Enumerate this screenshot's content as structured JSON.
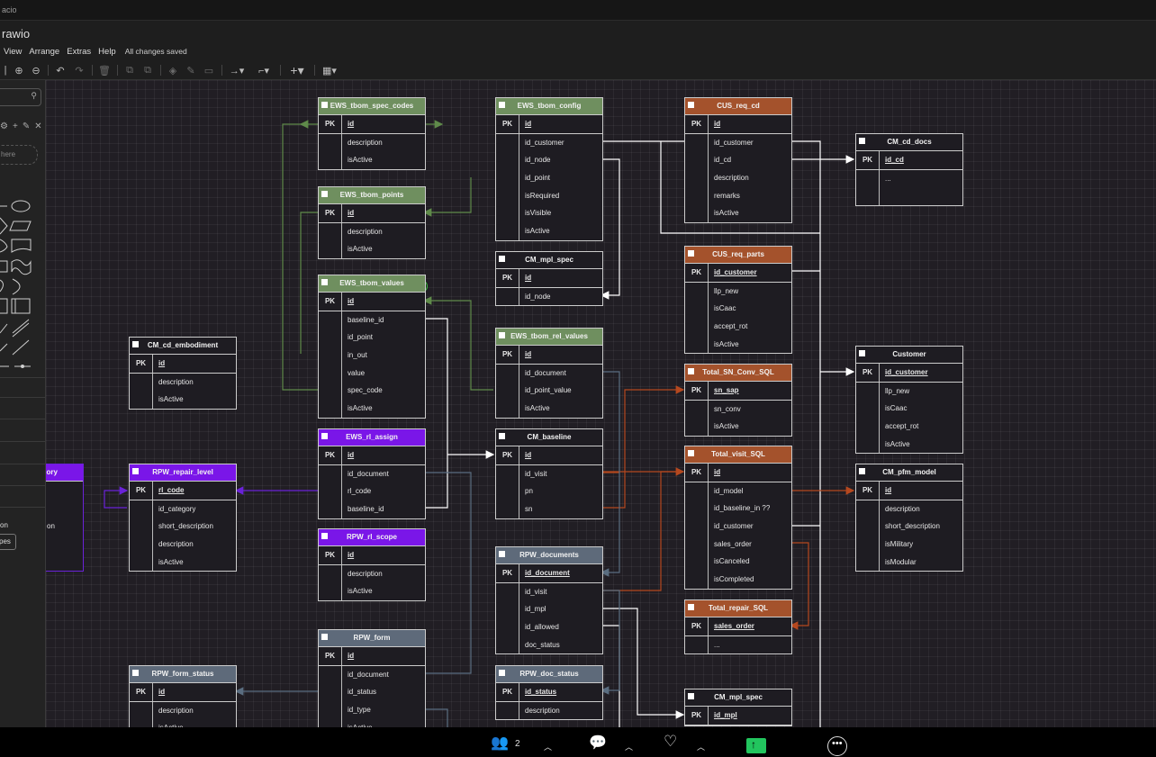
{
  "titlebar": {
    "text": "acio"
  },
  "app": {
    "title": "rawio"
  },
  "menu": {
    "items": [
      "View",
      "Arrange",
      "Extras",
      "Help"
    ],
    "status": "All changes saved"
  },
  "sidebar": {
    "drop_hint": "here",
    "partial_labels": {
      "category": "gory",
      "item": "on"
    },
    "button": "pes"
  },
  "tables": [
    {
      "name": "EWS_tbom_spec_codes",
      "color": "#6f8f5f",
      "pk": "id",
      "fields": [
        "description",
        "isActive"
      ]
    },
    {
      "name": "EWS_tbom_points",
      "color": "#6f8f5f",
      "pk": "id",
      "fields": [
        "description",
        "isActive"
      ]
    },
    {
      "name": "EWS_tbom_values",
      "color": "#6f8f5f",
      "pk": "id",
      "fields": [
        "baseline_id",
        "id_point",
        "in_out",
        "value",
        "spec_code",
        "isActive"
      ]
    },
    {
      "name": "EWS_tbom_config",
      "color": "#6f8f5f",
      "pk": "id",
      "fields": [
        "id_customer",
        "id_node",
        "id_point",
        "isRequired",
        "isVisible",
        "isActive"
      ]
    },
    {
      "name": "CM_mpl_spec",
      "color": "",
      "pk": "id",
      "fields": [
        "id_node"
      ]
    },
    {
      "name": "EWS_tbom_rel_values",
      "color": "#6f8f5f",
      "pk": "id",
      "fields": [
        "id_document",
        "id_point_value",
        "isActive"
      ]
    },
    {
      "name": "CM_baseline",
      "color": "",
      "pk": "id",
      "fields": [
        "id_visit",
        "pn",
        "sn"
      ]
    },
    {
      "name": "EWS_rl_assign",
      "color": "#7a16e8",
      "pk": "id",
      "fields": [
        "id_document",
        "rl_code",
        "baseline_id"
      ]
    },
    {
      "name": "RPW_rl_scope",
      "color": "#7a16e8",
      "pk": "id",
      "fields": [
        "description",
        "isActive"
      ]
    },
    {
      "name": "RPW_form",
      "color": "#5e6a7a",
      "pk": "id",
      "fields": [
        "id_document",
        "id_status",
        "id_type",
        "isActive"
      ]
    },
    {
      "name": "CM_cd_embodiment",
      "color": "",
      "pk": "id",
      "fields": [
        "description",
        "isActive"
      ]
    },
    {
      "name": "RPW_repair_level",
      "color": "#7a16e8",
      "pk": "rl_code",
      "fields": [
        "id_category",
        "short_description",
        "description",
        "isActive"
      ]
    },
    {
      "name": "RPW_form_status",
      "color": "#5e6a7a",
      "pk": "id",
      "fields": [
        "description",
        "isActive"
      ]
    },
    {
      "name": "RPW_documents",
      "color": "#5e6a7a",
      "pk": "id_document",
      "fields": [
        "id_visit",
        "id_mpl",
        "id_allowed",
        "doc_status"
      ]
    },
    {
      "name": "RPW_doc_status",
      "color": "#5e6a7a",
      "pk": "id_status",
      "fields": [
        "description"
      ]
    },
    {
      "name": "CUS_req_cd",
      "color": "#a4522c",
      "pk": "id",
      "fields": [
        "id_customer",
        "id_cd",
        "description",
        "remarks",
        "isActive"
      ]
    },
    {
      "name": "CUS_req_parts",
      "color": "#a4522c",
      "pk": "id_customer",
      "fields": [
        "llp_new",
        "isCaac",
        "accept_rot",
        "isActive"
      ]
    },
    {
      "name": "Total_SN_Conv_SQL",
      "color": "#a4522c",
      "pk": "sn_sap",
      "fields": [
        "sn_conv",
        "isActive"
      ]
    },
    {
      "name": "Total_visit_SQL",
      "color": "#a4522c",
      "pk": "id",
      "fields": [
        "id_model",
        "id_baseline_in ??",
        "id_customer",
        "sales_order",
        "isCanceled",
        "isCompleted"
      ]
    },
    {
      "name": "Total_repair_SQL",
      "color": "#a4522c",
      "pk": "sales_order",
      "fields": [
        "..."
      ]
    },
    {
      "name": "CM_mpl_spec",
      "color": "",
      "pk": "id_mpl",
      "fields": []
    },
    {
      "name": "CM_cd_docs",
      "color": "",
      "pk": "id_cd",
      "fields": [
        "..."
      ]
    },
    {
      "name": "Customer",
      "color": "",
      "pk": "id_customer",
      "fields": [
        "llp_new",
        "isCaac",
        "accept_rot",
        "isActive"
      ]
    },
    {
      "name": "CM_pfm_model",
      "color": "",
      "pk": "id",
      "fields": [
        "description",
        "short_description",
        "isMilitary",
        "isModular"
      ]
    },
    {
      "name": "gory",
      "color": "#7a16e8",
      "pk": "",
      "fields": []
    }
  ],
  "taskbar": {
    "participants": "2"
  }
}
